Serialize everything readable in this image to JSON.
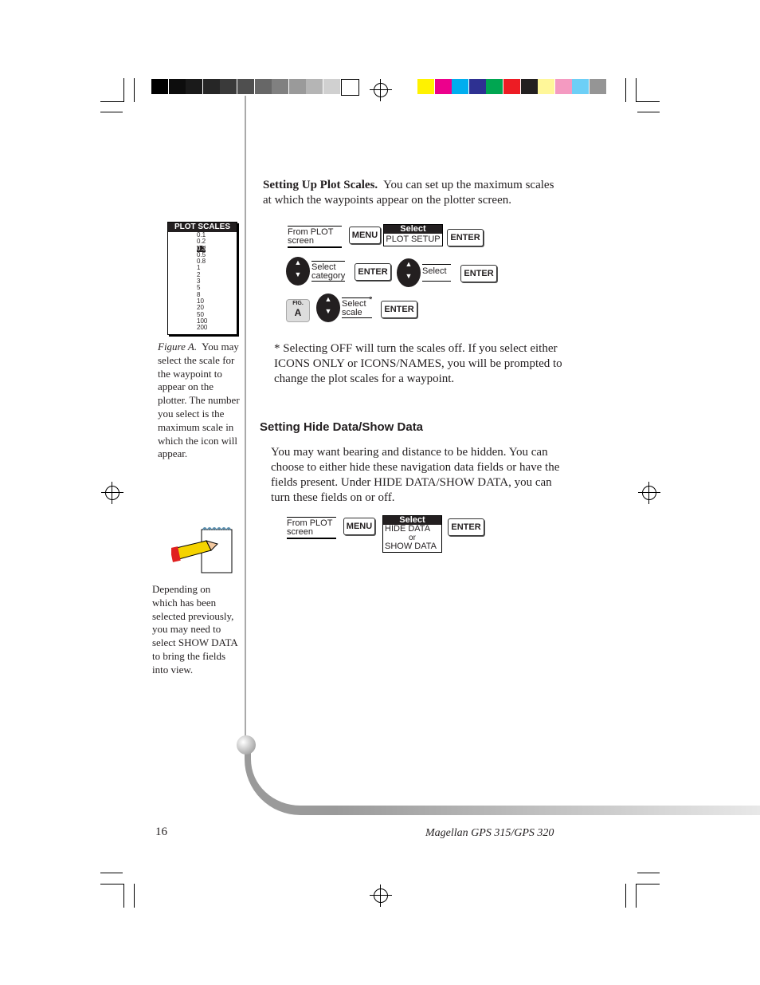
{
  "color_bars": {
    "gray": [
      "#000000",
      "#0d0d0d",
      "#1a1a1a",
      "#262626",
      "#3a3a3a",
      "#4f4f4f",
      "#676767",
      "#808080",
      "#9a9a9a",
      "#b5b5b5",
      "#d0d0d0",
      "#ffffff"
    ],
    "color": [
      "#fff200",
      "#ec008c",
      "#00aeef",
      "#2e3192",
      "#00a651",
      "#ed1c24",
      "#231f20",
      "#fff799",
      "#f49ac1",
      "#6dcff6",
      "#959595"
    ]
  },
  "intro": {
    "heading": "Setting Up Plot Scales.",
    "text": "You can set up the maximum scales at which the waypoints appear on the plotter screen."
  },
  "plot_scales": {
    "title": "PLOT SCALES",
    "items": [
      "0.1",
      "0.2",
      "0.3",
      "0.5",
      "0.8",
      "1",
      "2",
      "3",
      "5",
      "8",
      "10",
      "20",
      "50",
      "100",
      "200"
    ],
    "selected": "0.3"
  },
  "figure_caption": {
    "label": "Figure A.",
    "text": "You may select the scale for the waypoint to appear on the plotter. The number you select is the maximum scale in which the icon will appear."
  },
  "flow1": {
    "from": "From PLOT screen",
    "menu": "MENU",
    "select_header": "Select",
    "select_value": "PLOT SETUP",
    "enter": "ENTER",
    "select_category": "Select category",
    "select": "Select",
    "fig_label": "FIG.",
    "fig_letter": "A",
    "select_scale": "Select scale",
    "asterisk": "*"
  },
  "note": "* Selecting OFF will turn the scales off.  If you select either ICONS ONLY or ICONS/NAMES, you will be prompted to change the plot scales for a waypoint.",
  "section2": {
    "heading": "Setting Hide Data/Show Data",
    "text": "You may want bearing and distance to be hidden.  You can choose to either hide these navigation data fields or have the fields present.  Under HIDE DATA/SHOW DATA, you can turn these fields on or off."
  },
  "flow2": {
    "from": "From PLOT screen",
    "menu": "MENU",
    "select_header": "Select",
    "opt1": "HIDE DATA",
    "or": "or",
    "opt2": "SHOW DATA",
    "enter": "ENTER"
  },
  "side_note": "Depending on which has been selected previously, you may need to select SHOW DATA to bring the fields into view.",
  "footer": {
    "page": "16",
    "title": "Magellan GPS 315/GPS 320"
  }
}
